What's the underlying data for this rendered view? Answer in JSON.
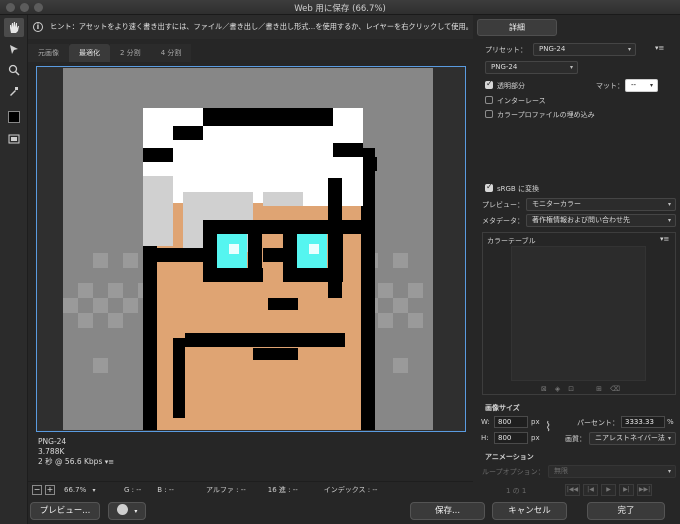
{
  "window": {
    "title": "Web 用に保存 (66.7%)"
  },
  "hint": {
    "text": "ヒント：アセットをより速く書き出すには、ファイル／書き出し／書き出し形式...を使用するか、レイヤーを右クリックして使用。"
  },
  "detail_button": "詳細",
  "tabs": [
    "元画像",
    "最適化",
    "2 分割",
    "4 分割"
  ],
  "image_info": {
    "format": "PNG-24",
    "size": "3.788K",
    "time": "2 秒 @ 56.6 Kbps"
  },
  "status": {
    "zoom": "66.7%",
    "g": "G : --",
    "b": "B : --",
    "alpha": "アルファ : --",
    "hex": "16 進 : --",
    "index": "インデックス : --"
  },
  "buttons": {
    "preview": "プレビュー...",
    "save": "保存...",
    "cancel": "キャンセル",
    "done": "完了"
  },
  "preset": {
    "label": "プリセット：",
    "value": "PNG-24",
    "format": "PNG-24"
  },
  "options": {
    "transparency": "透明部分",
    "matte_label": "マット：",
    "matte_value": "--",
    "interlace": "インターレース",
    "profile": "カラープロファイルの埋め込み",
    "srgb": "sRGB に変換",
    "preview_label": "プレビュー：",
    "preview_value": "モニターカラー",
    "metadata_label": "メタデータ：",
    "metadata_value": "著作権情報および問い合わせ先"
  },
  "color_table": {
    "title": "カラーテーブル"
  },
  "image_size": {
    "title": "画像サイズ",
    "w_label": "W:",
    "w_value": "800",
    "h_label": "H:",
    "h_value": "800",
    "unit": "px",
    "percent_label": "パーセント：",
    "percent_value": "3333.33",
    "percent_unit": "%",
    "quality_label": "画質：",
    "quality_value": "ニアレストネイバー法"
  },
  "animation": {
    "title": "アニメーション",
    "loop_label": "ループオプション：",
    "loop_value": "無限",
    "frame_counter": "1 の 1"
  },
  "colors": {
    "skin": "#dfa473",
    "hair": "#ffffff",
    "hair_shadow": "#d0d0d0",
    "outline": "#000000",
    "lens": "#55f5f0",
    "bg": "#878787",
    "accent": "#5a9be0"
  }
}
